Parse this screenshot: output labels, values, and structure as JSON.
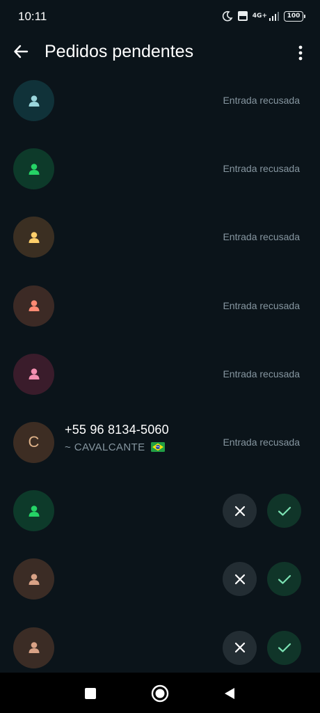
{
  "status_bar": {
    "time": "10:11",
    "battery": "100",
    "network": "4G+"
  },
  "app_bar": {
    "title": "Pedidos pendentes"
  },
  "requests": [
    {
      "avatar_bg": "#103239",
      "icon_color": "#9ad6dc",
      "status": "Entrada recusada"
    },
    {
      "avatar_bg": "#0d3a2a",
      "icon_color": "#25d366",
      "status": "Entrada recusada"
    },
    {
      "avatar_bg": "#3b2f22",
      "icon_color": "#ffcf6b",
      "status": "Entrada recusada"
    },
    {
      "avatar_bg": "#3c2a25",
      "icon_color": "#ff8a73",
      "status": "Entrada recusada"
    },
    {
      "avatar_bg": "#3a1c2b",
      "icon_color": "#f48fb1",
      "status": "Entrada recusada"
    },
    {
      "avatar_bg": "#3d2d23",
      "letter": "C",
      "name": "+55 96 8134-5060",
      "subtitle": "~ CAVALCANTE",
      "status": "Entrada recusada"
    },
    {
      "avatar_bg": "#0d3a2a",
      "icon_color": "#25d366",
      "actions": true
    },
    {
      "avatar_bg": "#3b2c25",
      "icon_color": "#d9a286",
      "actions": true
    },
    {
      "avatar_bg": "#3b2c25",
      "icon_color": "#d9a286",
      "actions": true
    }
  ],
  "colors": {
    "background": "#0b141a",
    "secondary_text": "#8696a0",
    "accent": "#25d366"
  }
}
